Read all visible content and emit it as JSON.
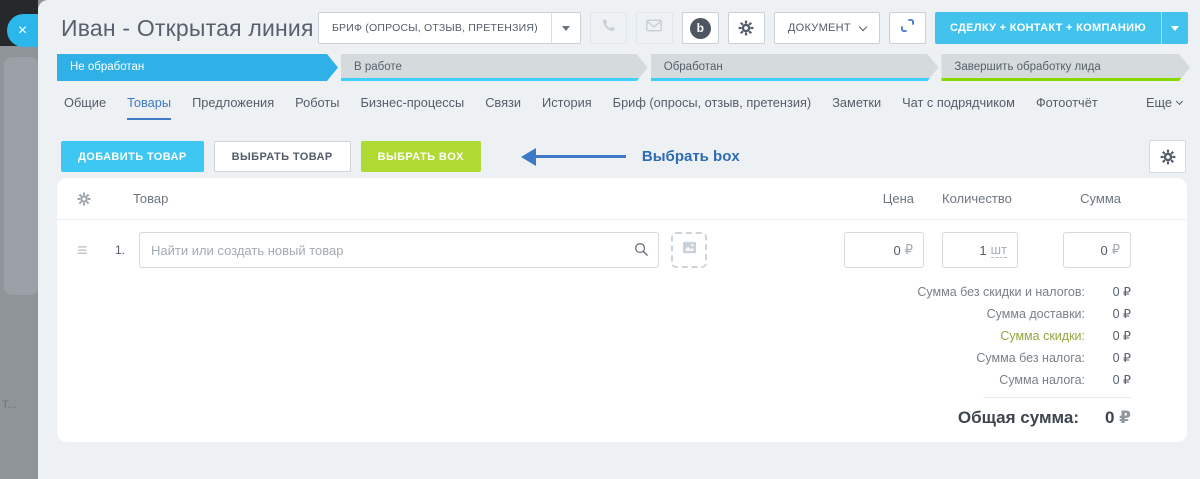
{
  "colors": {
    "stage_active_blue": "#2fb1e8",
    "stage_stripe_cyan": "#3ed0fa",
    "stage_stripe_green": "#86d800",
    "add_button_cyan": "#3ec7f3",
    "box_button_green": "#aeda31",
    "create_button_cyan": "#42c3ee",
    "annotation_blue": "#2d6cb3",
    "active_tab_blue": "#3f79c8",
    "panel_background": "#eef1f4"
  },
  "overlay": {
    "close_icon": "×",
    "background_text": "Т..."
  },
  "header": {
    "title": "Иван - Открытая линия",
    "brief_button": "БРИФ (ОПРОСЫ, ОТЗЫВ, ПРЕТЕНЗИЯ)",
    "document_button": "ДОКУМЕНТ",
    "create_button": "СДЕЛКУ + КОНТАКТ + КОМПАНИЮ",
    "messenger_glyph": "b"
  },
  "stages": [
    {
      "label": "Не обработан",
      "state": "active"
    },
    {
      "label": "В работе",
      "accent": "cyan"
    },
    {
      "label": "Обработан",
      "accent": "cyan"
    },
    {
      "label": "Завершить обработку лида",
      "accent": "green"
    }
  ],
  "tabs": {
    "items": [
      "Общие",
      "Товары",
      "Предложения",
      "Роботы",
      "Бизнес-процессы",
      "Связи",
      "История",
      "Бриф (опросы, отзыв, претензия)",
      "Заметки",
      "Чат с подрядчиком",
      "Фотоотчёт"
    ],
    "active": "Товары",
    "more": "Еще"
  },
  "toolbar": {
    "add_product": "ДОБАВИТЬ ТОВАР",
    "select_product": "ВЫБРАТЬ ТОВАР",
    "select_box": "ВЫБРАТЬ BOX",
    "annotation": "Выбрать box"
  },
  "table": {
    "columns": {
      "product": "Товар",
      "price": "Цена",
      "quantity": "Количество",
      "sum": "Сумма"
    },
    "row": {
      "index": "1.",
      "search_placeholder": "Найти или создать новый товар",
      "price_value": "0",
      "price_currency": "₽",
      "quantity_value": "1",
      "quantity_unit": "шт",
      "sum_value": "0",
      "sum_currency": "₽"
    }
  },
  "totals": {
    "rows": [
      {
        "label": "Сумма без скидки и налогов:",
        "value": "0 ₽"
      },
      {
        "label": "Сумма доставки:",
        "value": "0 ₽"
      },
      {
        "label": "Сумма скидки:",
        "value": "0 ₽",
        "highlight": "green"
      },
      {
        "label": "Сумма без налога:",
        "value": "0 ₽"
      },
      {
        "label": "Сумма налога:",
        "value": "0 ₽"
      }
    ],
    "total_label": "Общая сумма:",
    "total_value": "0",
    "total_currency": "₽"
  }
}
